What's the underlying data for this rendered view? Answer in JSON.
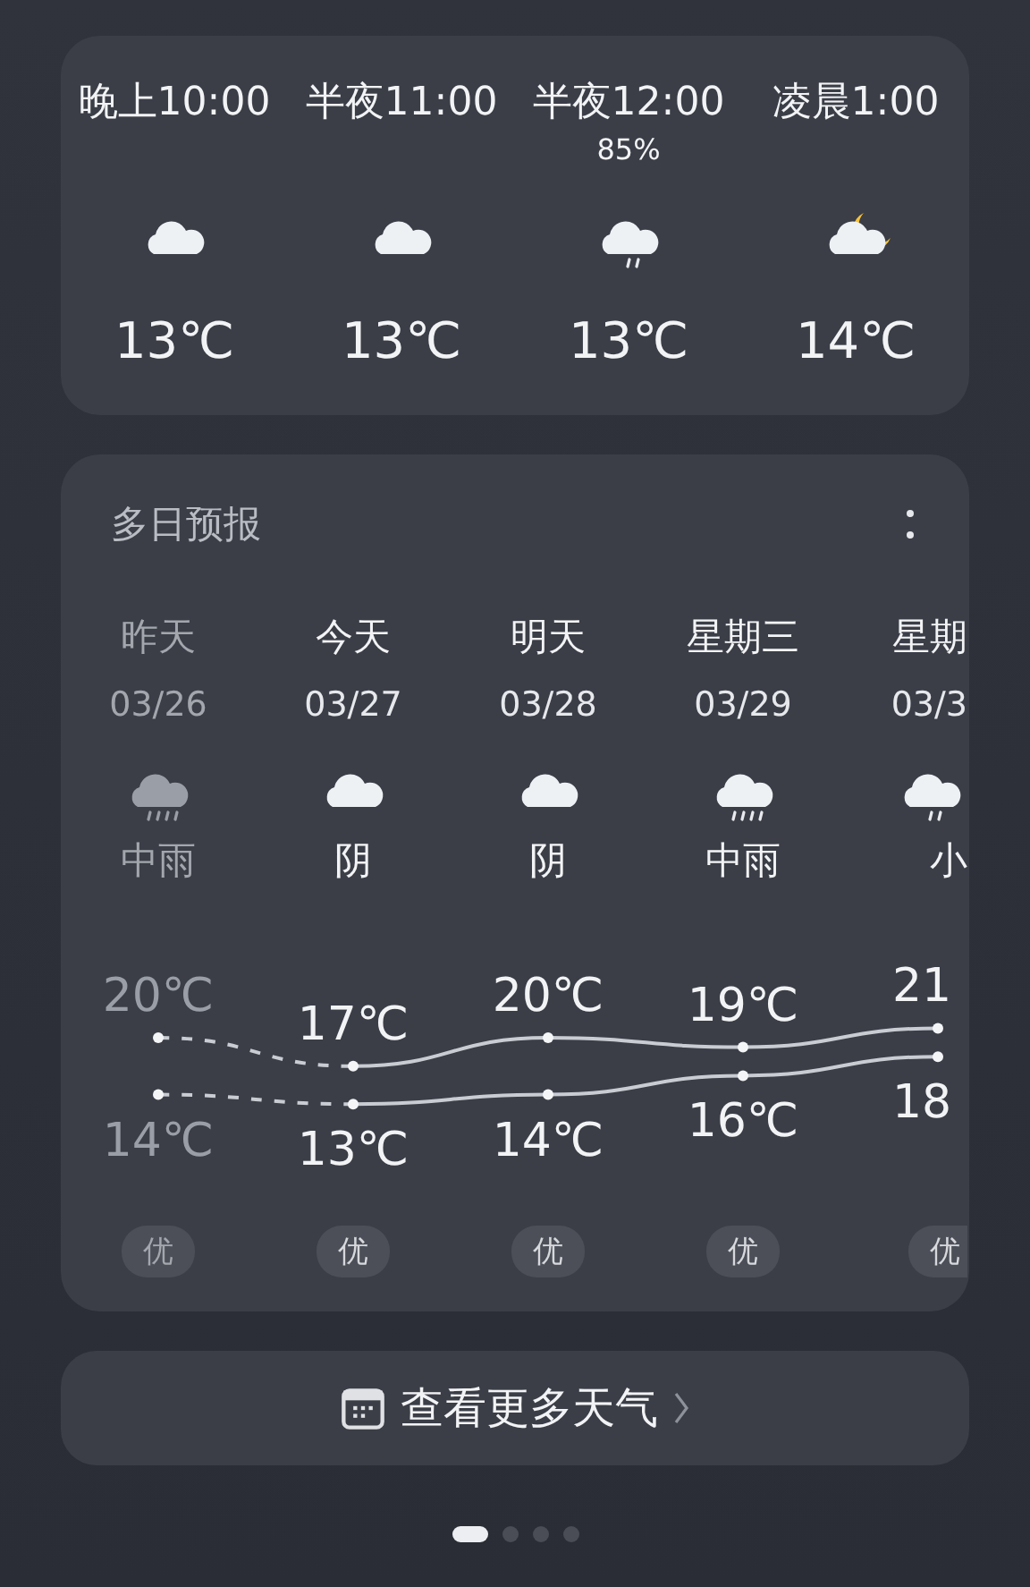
{
  "hourly": [
    {
      "time": "晚上10:00",
      "kind": "cloudy",
      "temp": "13℃"
    },
    {
      "time": "半夜11:00",
      "kind": "cloudy",
      "temp": "13℃"
    },
    {
      "time": "半夜12:00",
      "precip": "85%",
      "kind": "light_rain",
      "temp": "13℃"
    },
    {
      "time": "凌晨1:00",
      "kind": "night_cloudy",
      "temp": "14℃"
    }
  ],
  "daily": {
    "title": "多日预报",
    "days": [
      {
        "label": "昨天",
        "date": "03/26",
        "kind": "moderate_rain",
        "condition": "中雨",
        "high": "20℃",
        "low": "14℃",
        "aqi": "优",
        "past": true
      },
      {
        "label": "今天",
        "date": "03/27",
        "kind": "cloudy",
        "condition": "阴",
        "high": "17℃",
        "low": "13℃",
        "aqi": "优",
        "past": false
      },
      {
        "label": "明天",
        "date": "03/28",
        "kind": "cloudy",
        "condition": "阴",
        "high": "20℃",
        "low": "14℃",
        "aqi": "优",
        "past": false
      },
      {
        "label": "星期三",
        "date": "03/29",
        "kind": "moderate_rain",
        "condition": "中雨",
        "high": "19℃",
        "low": "16℃",
        "aqi": "优",
        "past": false
      },
      {
        "label": "星期",
        "date": "03/3",
        "kind": "light_rain",
        "condition": "小",
        "high": "21",
        "low": "18",
        "aqi": "优",
        "past": false
      }
    ]
  },
  "more_button": {
    "label": "查看更多天气"
  },
  "pages": [
    {
      "selected": true
    },
    {
      "selected": false
    },
    {
      "selected": false
    },
    {
      "selected": false
    }
  ]
}
